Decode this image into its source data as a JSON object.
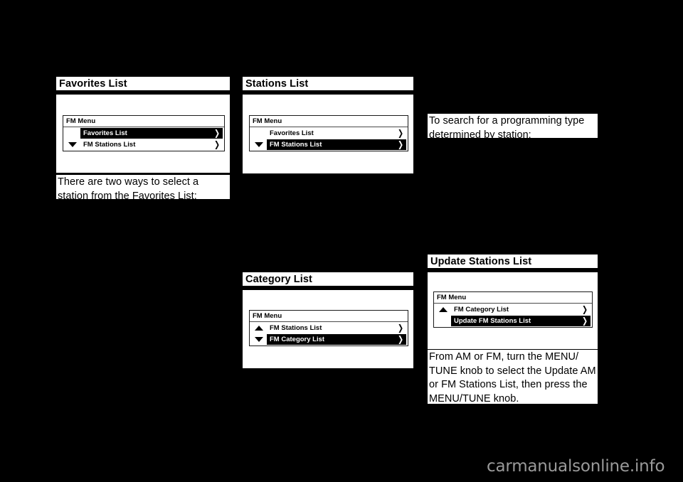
{
  "page": {
    "background_color": "#000000",
    "content_color": "#ffffff",
    "watermark": "carmanualsonline.info",
    "watermark_color": "#9a9a9a"
  },
  "columns": [
    {
      "id": "column-1",
      "sections": [
        {
          "id": "favorites-list",
          "heading": "Favorites List",
          "figure": {
            "id": "fm-menu-favorites",
            "title": "FM Menu",
            "rows": [
              {
                "arrow": "none",
                "label": "Favorites List",
                "chevron": "❯",
                "selected": true
              },
              {
                "arrow": "down",
                "label": "FM Stations List",
                "chevron": "❯",
                "selected": false
              }
            ]
          },
          "paragraph": "There are two ways to select a station from the Favorites List:"
        }
      ]
    },
    {
      "id": "column-2",
      "sections": [
        {
          "id": "stations-list",
          "heading": "Stations List",
          "figure": {
            "id": "fm-menu-stations",
            "title": "FM Menu",
            "rows": [
              {
                "arrow": "none",
                "label": "Favorites List",
                "chevron": "❯",
                "selected": false
              },
              {
                "arrow": "down",
                "label": "FM Stations List",
                "chevron": "❯",
                "selected": true
              }
            ]
          }
        },
        {
          "id": "category-list",
          "heading": "Category List",
          "figure": {
            "id": "fm-menu-category",
            "title": "FM Menu",
            "rows": [
              {
                "arrow": "up",
                "label": "FM Stations List",
                "chevron": "❯",
                "selected": false
              },
              {
                "arrow": "down",
                "label": "FM Category List",
                "chevron": "❯",
                "selected": true
              }
            ]
          }
        }
      ]
    },
    {
      "id": "column-3",
      "sections": [
        {
          "id": "search-programming-type",
          "paragraph": "To search for a programming type determined by station:"
        },
        {
          "id": "update-stations-list",
          "heading": "Update Stations List",
          "figure": {
            "id": "fm-menu-update",
            "title": "FM Menu",
            "rows": [
              {
                "arrow": "up",
                "label": "FM Category List",
                "chevron": "❯",
                "selected": false
              },
              {
                "arrow": "none",
                "label": "Update FM Stations List",
                "chevron": "❯",
                "selected": true
              }
            ]
          },
          "paragraph": "From AM or FM, turn the MENU/ TUNE knob to select the Update AM or FM Stations List, then press the MENU/TUNE knob."
        }
      ]
    }
  ]
}
